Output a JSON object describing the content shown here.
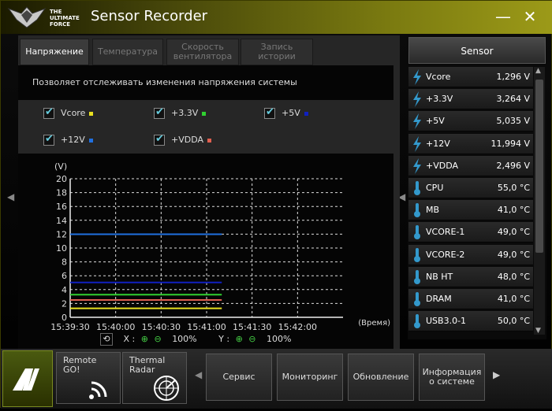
{
  "window": {
    "title": "Sensor Recorder",
    "logo_text": "THE\nULTIMATE\nFORCE",
    "minimize_glyph": "—",
    "close_glyph": "✕"
  },
  "tabs": [
    {
      "label": "Напряжение",
      "active": true
    },
    {
      "label": "Температура",
      "active": false
    },
    {
      "label": "Скорость вентилятора",
      "active": false
    },
    {
      "label": "Запись истории",
      "active": false
    }
  ],
  "description": "Позволяет отслеживать изменения напряжения системы",
  "checkboxes": [
    {
      "label": "Vcore",
      "color": "#e8e020"
    },
    {
      "label": "+3.3V",
      "color": "#30d030"
    },
    {
      "label": "+5V",
      "color": "#1020c0"
    },
    {
      "label": "+12V",
      "color": "#2070e0"
    },
    {
      "label": "+VDDA",
      "color": "#e06050"
    }
  ],
  "zoom": {
    "x_label": "X :",
    "x_value": "100%",
    "y_label": "Y :",
    "y_value": "100%"
  },
  "chart_data": {
    "type": "line",
    "ylabel": "(V)",
    "xlabel": "(Время)",
    "ylim": [
      0,
      20
    ],
    "yticks": [
      0,
      2,
      4,
      6,
      8,
      10,
      12,
      14,
      16,
      18,
      20
    ],
    "x_ticks": [
      "15:39:30",
      "15:40:00",
      "15:40:30",
      "15:41:00",
      "15:41:30",
      "15:42:00"
    ],
    "x_range_seconds": [
      0,
      180
    ],
    "grid": true,
    "series": [
      {
        "name": "+12V",
        "color": "#2070e0",
        "x": [
          0,
          100
        ],
        "values": [
          11.994,
          11.994
        ]
      },
      {
        "name": "+5V",
        "color": "#1020c0",
        "x": [
          0,
          100
        ],
        "values": [
          5.035,
          5.035
        ]
      },
      {
        "name": "+3.3V",
        "color": "#30d030",
        "x": [
          0,
          100
        ],
        "values": [
          3.264,
          3.264
        ]
      },
      {
        "name": "+VDDA",
        "color": "#e06050",
        "x": [
          0,
          100
        ],
        "values": [
          2.496,
          2.496
        ]
      },
      {
        "name": "Vcore",
        "color": "#e8e020",
        "x": [
          0,
          100
        ],
        "values": [
          1.296,
          1.296
        ]
      }
    ]
  },
  "sensor_panel": {
    "header": "Sensor",
    "rows": [
      {
        "icon": "voltage-icon",
        "name": "Vcore",
        "value": "1,296  V"
      },
      {
        "icon": "voltage-icon",
        "name": "+3.3V",
        "value": "3,264  V"
      },
      {
        "icon": "voltage-icon",
        "name": "+5V",
        "value": "5,035  V"
      },
      {
        "icon": "voltage-icon",
        "name": "+12V",
        "value": "11,994  V"
      },
      {
        "icon": "voltage-icon",
        "name": "+VDDA",
        "value": "2,496  V"
      },
      {
        "icon": "thermometer-icon",
        "name": "CPU",
        "value": "55,0 °C"
      },
      {
        "icon": "thermometer-icon",
        "name": "MB",
        "value": "41,0 °C"
      },
      {
        "icon": "thermometer-icon",
        "name": "VCORE-1",
        "value": "49,0 °C"
      },
      {
        "icon": "thermometer-icon",
        "name": "VCORE-2",
        "value": "49,0 °C"
      },
      {
        "icon": "thermometer-icon",
        "name": "NB HT",
        "value": "48,0 °C"
      },
      {
        "icon": "thermometer-icon",
        "name": "DRAM",
        "value": "41,0 °C"
      },
      {
        "icon": "thermometer-icon",
        "name": "USB3.0-1",
        "value": "50,0 °C"
      }
    ]
  },
  "bottom": {
    "tiles": [
      {
        "label": "Remote GO!",
        "icon": "wifi-icon"
      },
      {
        "label": "Thermal Radar",
        "icon": "radar-icon"
      }
    ],
    "nav": [
      "Сервис",
      "Мониторинг",
      "Обновление",
      "Информация о системе"
    ]
  },
  "colors": {
    "accent": "#9c9a18",
    "series_active_check": "#66ccdd"
  }
}
